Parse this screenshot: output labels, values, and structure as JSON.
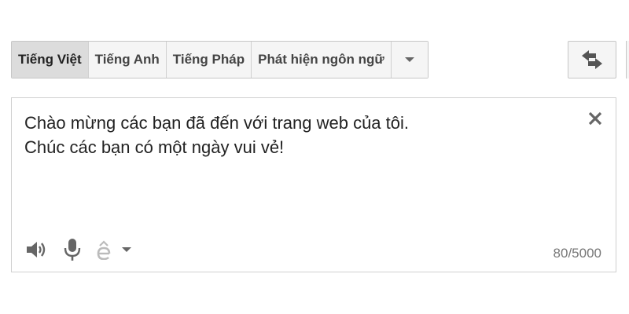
{
  "language_bar": {
    "tabs": [
      {
        "label": "Tiếng Việt",
        "active": true
      },
      {
        "label": "Tiếng Anh",
        "active": false
      },
      {
        "label": "Tiếng Pháp",
        "active": false
      },
      {
        "label": "Phát hiện ngôn ngữ",
        "active": false
      }
    ],
    "more_icon": "chevron-down-icon"
  },
  "swap_button": {
    "icon": "swap-languages-icon"
  },
  "source": {
    "lines": [
      "Chào mừng các bạn đã đến với trang web của tôi.",
      "Chúc các bạn có một ngày vui vẻ!"
    ],
    "clear_icon": "close-icon",
    "char_count": "80/5000"
  },
  "toolbar": {
    "icons": [
      "speaker-icon",
      "microphone-icon",
      "input-tools-icon",
      "chevron-down-icon"
    ]
  },
  "colors": {
    "active_tab_bg": "#dcdcdc",
    "tab_bg": "#f5f5f5",
    "border": "#c6c6c6",
    "icon": "#666666",
    "icon_disabled": "#bbbbbb"
  }
}
